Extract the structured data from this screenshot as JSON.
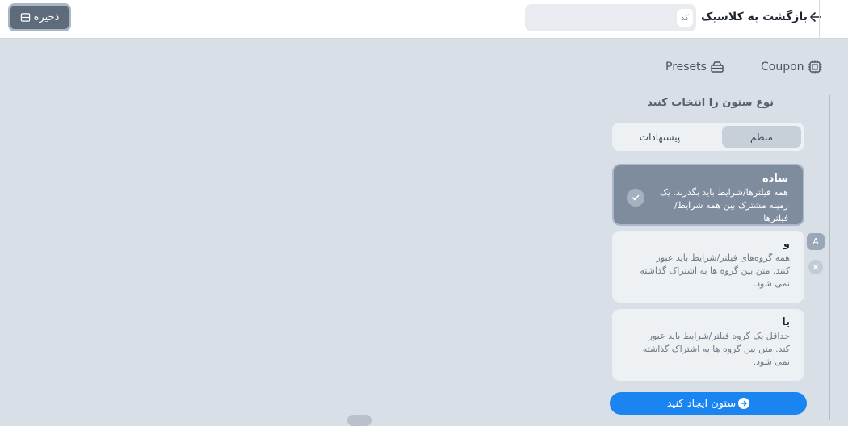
{
  "header": {
    "save_label": "ذخیره",
    "back_label": "بازگشت به کلاسیک",
    "code_placeholder": "کد"
  },
  "tabs": {
    "coupon": "Coupon",
    "presets": "Presets"
  },
  "panel": {
    "title": "نوع ستون را انتخاب کنید",
    "segment": {
      "active": "منظم",
      "other": "پیشنهادات"
    },
    "options": [
      {
        "title": "ساده",
        "desc": "همه فیلترها/شرایط باید بگذرند. یک زمینه مشترک بین همه شرایط/فیلترها.",
        "selected": true
      },
      {
        "title": "و",
        "desc": "همه گروه‌های فیلتر/شرایط باید عبور کنند. متن بین گروه ها به اشتراک گذاشته نمی شود.",
        "selected": false
      },
      {
        "title": "یا",
        "desc": "حداقل یک گروه فیلتر/شرایط باید عبور کند. متن بین گروه ها به اشتراک گذاشته نمی شود.",
        "selected": false
      }
    ],
    "badge_letter": "A",
    "create_label": "ستون ایجاد کنید"
  },
  "colors": {
    "accent": "#1a84f0",
    "background": "#d9dfe6",
    "selected_card": "#7f8c9e"
  }
}
